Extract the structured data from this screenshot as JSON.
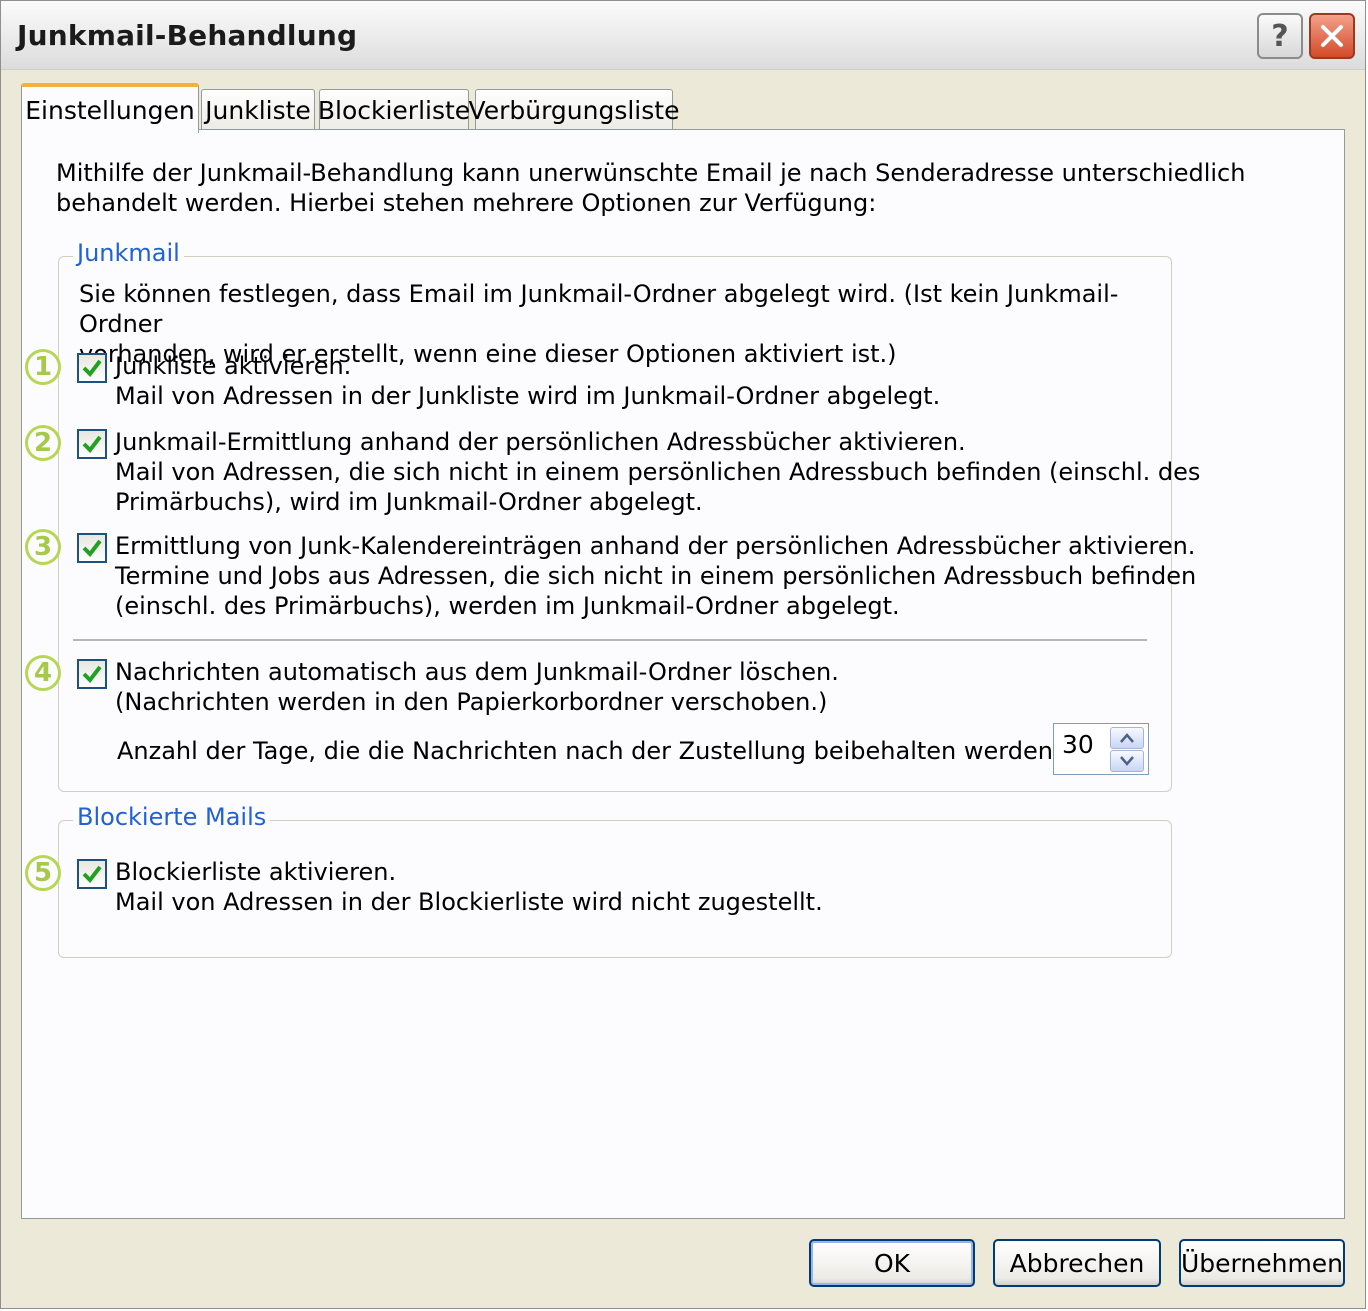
{
  "window": {
    "title": "Junkmail-Behandlung",
    "help_glyph": "?"
  },
  "tabs": [
    {
      "label": "Einstellungen",
      "active": true
    },
    {
      "label": "Junkliste",
      "active": false
    },
    {
      "label": "Blockierliste",
      "active": false
    },
    {
      "label": "Verbürgungsliste",
      "active": false
    }
  ],
  "intro": {
    "line1": "Mithilfe der Junkmail-Behandlung kann unerwünschte Email je nach Senderadresse unterschiedlich",
    "line2": "behandelt werden. Hierbei stehen mehrere Optionen zur Verfügung:"
  },
  "junkmail": {
    "legend": "Junkmail",
    "desc1": "Sie können festlegen, dass Email im Junkmail-Ordner abgelegt wird. (Ist kein Junkmail-Ordner",
    "desc2": "vorhanden, wird er erstellt, wenn eine dieser Optionen aktiviert ist.)",
    "options": [
      {
        "marker": "1",
        "checked": true,
        "lines": [
          "Junkliste aktivieren.",
          "Mail von Adressen in der Junkliste wird im Junkmail-Ordner abgelegt."
        ]
      },
      {
        "marker": "2",
        "checked": true,
        "lines": [
          "Junkmail-Ermittlung anhand der persönlichen Adressbücher aktivieren.",
          "Mail von Adressen, die sich nicht in einem persönlichen Adressbuch befinden (einschl. des",
          "Primärbuchs), wird im Junkmail-Ordner abgelegt."
        ]
      },
      {
        "marker": "3",
        "checked": true,
        "lines": [
          "Ermittlung von Junk-Kalendereinträgen anhand der persönlichen Adressbücher aktivieren.",
          "Termine und Jobs aus Adressen, die sich nicht in einem persönlichen Adressbuch befinden",
          "(einschl. des Primärbuchs), werden im Junkmail-Ordner abgelegt."
        ]
      },
      {
        "marker": "4",
        "checked": true,
        "lines": [
          "Nachrichten automatisch aus dem Junkmail-Ordner löschen.",
          "(Nachrichten werden in den Papierkorbordner verschoben.)"
        ]
      }
    ],
    "days_label": "Anzahl der Tage, die die Nachrichten nach der Zustellung beibehalten werden sollen:",
    "days_value": "30"
  },
  "blocked": {
    "legend": "Blockierte Mails",
    "options": [
      {
        "marker": "5",
        "checked": true,
        "lines": [
          "Blockierliste aktivieren.",
          "Mail von Adressen in der Blockierliste wird nicht zugestellt."
        ]
      }
    ]
  },
  "buttons": {
    "ok": "OK",
    "cancel": "Abbrechen",
    "apply": "Übernehmen"
  },
  "colors": {
    "accent_tab": "#f2b33d",
    "legend_text": "#2161d6",
    "marker": "#b8d655",
    "check": "#21a121"
  }
}
